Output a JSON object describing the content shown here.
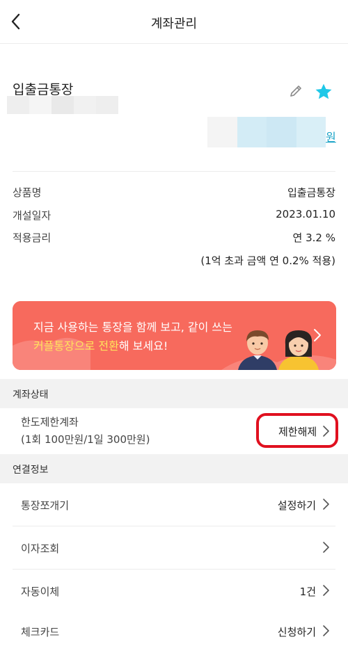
{
  "header": {
    "title": "계좌관리",
    "back_icon": "chevron-left-icon"
  },
  "account": {
    "name": "입출금통장",
    "balance_unit": "원",
    "edit_icon": "pencil-icon",
    "favorite_icon": "star-icon",
    "favorite_color": "#1fc8e8"
  },
  "details": [
    {
      "label": "상품명",
      "value": "입출금통장"
    },
    {
      "label": "개설일자",
      "value": "2023.01.10"
    },
    {
      "label": "적용금리",
      "value": "연 3.2 %"
    }
  ],
  "rate_note": "(1억 초과 금액 연 0.2% 적용)",
  "banner": {
    "line1": "지금 사용하는 통장을 함께 보고, 같이 쓰는",
    "line2_highlight": "커플통장으로 전환",
    "line2_rest": "해 보세요!",
    "background_color": "#f76a5d",
    "highlight_color": "#ffe25c"
  },
  "status_section": {
    "title": "계좌상태",
    "status_name": "한도제한계좌",
    "status_limit": "(1회 100만원/1일 300만원)",
    "unlock_label": "제한해제"
  },
  "connection_section": {
    "title": "연결정보",
    "rows": [
      {
        "label": "통장쪼개기",
        "value": "설정하기"
      },
      {
        "label": "이자조회",
        "value": ""
      },
      {
        "label": "자동이체",
        "value": "1건"
      },
      {
        "label": "체크카드",
        "value": "신청하기"
      }
    ]
  }
}
